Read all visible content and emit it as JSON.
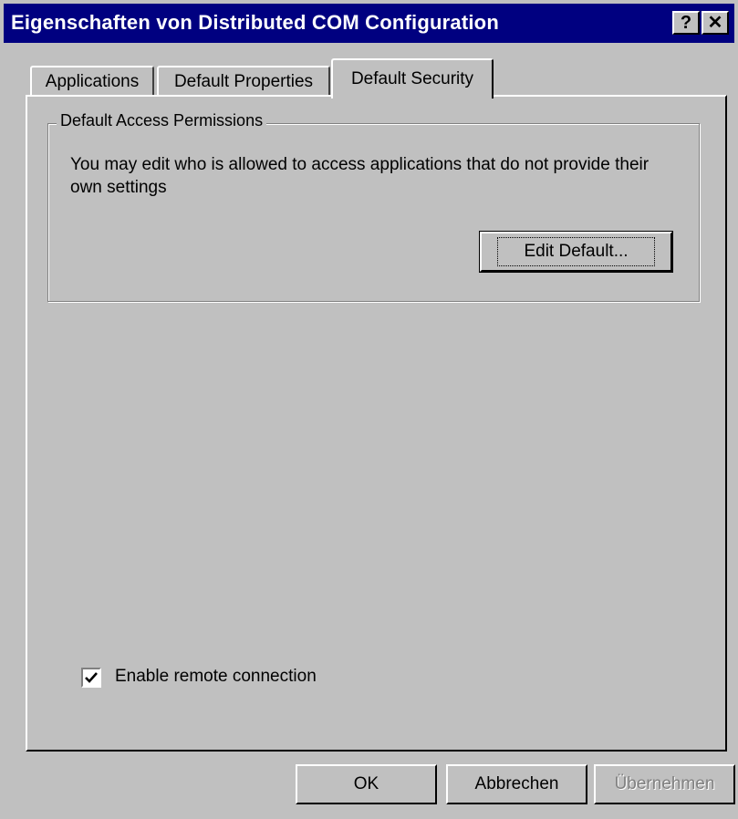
{
  "window": {
    "title": "Eigenschaften von Distributed COM Configuration",
    "help_label": "?",
    "close_label": "✕"
  },
  "tabs": [
    {
      "label": "Applications",
      "active": false
    },
    {
      "label": "Default Properties",
      "active": false
    },
    {
      "label": "Default Security",
      "active": true
    }
  ],
  "access_group": {
    "legend": "Default Access Permissions",
    "description": "You may edit who is allowed to access applications that do not provide their own settings",
    "edit_button": "Edit Default..."
  },
  "remote": {
    "label": "Enable remote connection",
    "checked": true
  },
  "buttons": {
    "ok": "OK",
    "cancel": "Abbrechen",
    "apply": "Übernehmen"
  },
  "colors": {
    "title_bar": "#000080",
    "face": "#c0c0c0",
    "disabled_text": "#808080"
  }
}
